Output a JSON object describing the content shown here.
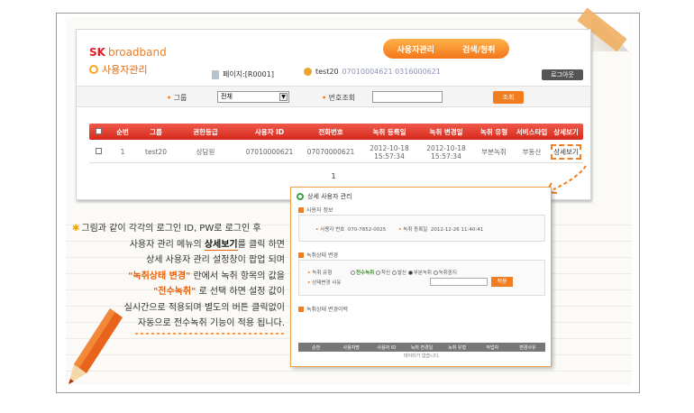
{
  "app": {
    "brand_sk": "SK",
    "brand_name": "broadband",
    "section_title": "사용자관리",
    "nav": [
      "사용자관리",
      "검색/청취"
    ],
    "page_id": "페이지:[R0001]",
    "user_id": "test20",
    "user_extra": "07010004621 0316000621",
    "logout": "로그아웃",
    "search": {
      "group_label": "그룹",
      "group_value": "전체",
      "phone_label": "번호조회",
      "phone_value": "",
      "button": "조회"
    },
    "grid": {
      "headers": [
        "순번",
        "그룹",
        "권한등급",
        "사용자 ID",
        "전화번호",
        "녹취 등록일",
        "녹취 변경일",
        "녹취 유형",
        "서비스타입",
        "상세보기"
      ],
      "rows": [
        [
          "1",
          "test20",
          "상담원",
          "07010000621",
          "07070000621",
          "2012-10-18 15:57:34",
          "2012-10-18 15:57:34",
          "부분녹취",
          "부동산",
          "상세보기"
        ]
      ],
      "page": "1"
    }
  },
  "popup": {
    "title": "상세 사용자 관리",
    "sec_user_info": "사용자 정보",
    "user_number_label": "사용자 번호",
    "user_number_value": "070-7852-0025",
    "reg_date_label": "녹취 등록일",
    "reg_date_value": "2012-12-26 11:40:41",
    "sec_change": "녹취상태 변경",
    "record_type_label": "녹취 유형",
    "options": [
      "전수녹취",
      "착신",
      "발신",
      "부분녹취",
      "녹취중지"
    ],
    "selected_option": "부분녹취",
    "reason_label": "상태변경 사유",
    "apply_button": "적용",
    "sec_history": "녹취상태 변경이력",
    "history_headers": [
      "순번",
      "사용자명",
      "사용자 ID",
      "녹취 변경일",
      "녹취 유형",
      "작업자",
      "변경사유"
    ],
    "history_empty": "데이터가 없습니다."
  },
  "caption": {
    "l1": "그림과 같이 각각의 로그인 ID, PW로 로그인 후",
    "l2a": "사용자 관리 메뉴의 ",
    "l2b": "상세보기",
    "l2c": "를 클릭 하면",
    "l3": "상세 사용자 관리 설정창이 팝업 되며",
    "l4a": "\"녹취상태 변경\"",
    "l4b": " 란에서 녹취 항목의 값을",
    "l5a": "\"전수녹취\"",
    "l5b": " 로 선택 하면 설정 값이",
    "l6": "실시간으로 적용되며 별도의 버튼 클릭없이",
    "l7": "자동으로 전수녹취 기능이 적용 됩니다."
  },
  "colors": {
    "accent": "#f07d1f",
    "brand": "#e31b23",
    "grid_header": "#e03a2c"
  }
}
